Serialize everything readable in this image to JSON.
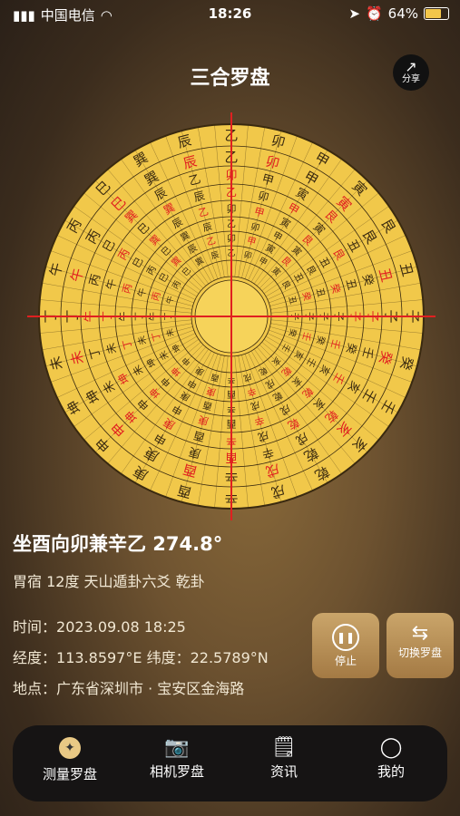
{
  "status": {
    "carrier": "中国电信",
    "time": "18:26",
    "battery": "64%",
    "battery_level": 0.64
  },
  "header": {
    "title": "三合罗盘",
    "share_label": "分享"
  },
  "reading": {
    "heading": "坐酉向卯兼辛乙 274.8°",
    "sub": "胃宿 12度 天山遁卦六爻 乾卦",
    "time_label": "时间：",
    "time_value": "2023.09.08 18:25",
    "lng_label": "经度：",
    "lng_value": "113.8597°E",
    "lat_label": "纬度：",
    "lat_value": "22.5789°N",
    "loc_label": "地点：",
    "loc_value": "广东省深圳市 · 宝安区金海路"
  },
  "controls": {
    "stop_label": "停止",
    "switch_label": "切换罗盘"
  },
  "compass_labels": {
    "outer": [
      "子",
      "丑",
      "艮",
      "寅",
      "甲",
      "卯",
      "乙",
      "辰",
      "巽",
      "巳",
      "丙",
      "午",
      "丁",
      "未",
      "坤",
      "申",
      "庚",
      "酉",
      "辛",
      "戌",
      "乾",
      "亥",
      "壬",
      "癸"
    ],
    "inner": [
      "子",
      "癸",
      "丑",
      "艮",
      "寅",
      "甲",
      "卯",
      "乙",
      "辰",
      "巽",
      "巳",
      "丙",
      "午",
      "丁",
      "未",
      "坤",
      "申",
      "庚",
      "酉",
      "辛",
      "戌",
      "乾",
      "亥",
      "壬"
    ]
  },
  "tabs": [
    {
      "label": "测量罗盘",
      "icon": "compass-icon"
    },
    {
      "label": "相机罗盘",
      "icon": "camera-icon"
    },
    {
      "label": "资讯",
      "icon": "bookmark-icon"
    },
    {
      "label": "我的",
      "icon": "user-icon"
    }
  ],
  "colors": {
    "gold": "#f1c84a",
    "red": "#e02020",
    "ink": "#3a2a10"
  }
}
